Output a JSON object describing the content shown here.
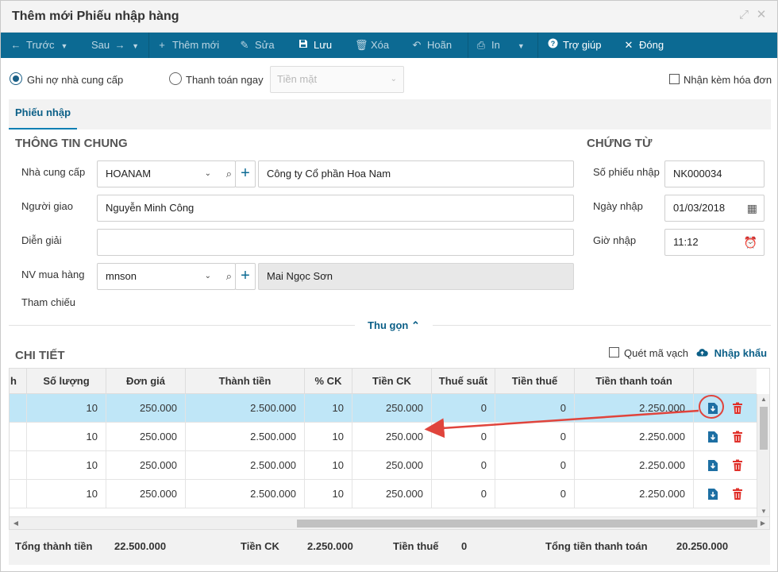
{
  "window": {
    "title": "Thêm mới Phiếu nhập hàng"
  },
  "toolbar": {
    "prev": "Trước",
    "next": "Sau",
    "add": "Thêm mới",
    "edit": "Sửa",
    "save": "Lưu",
    "delete": "Xóa",
    "undo": "Hoãn",
    "print": "In",
    "help": "Trợ giúp",
    "close": "Đóng"
  },
  "payment": {
    "debt_label": "Ghi nợ nhà cung cấp",
    "pay_now_label": "Thanh toán ngay",
    "method_placeholder": "Tiền mặt",
    "invoice_label": "Nhận kèm hóa đơn"
  },
  "tabs": {
    "main": "Phiếu nhập"
  },
  "general": {
    "heading": "THÔNG TIN CHUNG",
    "supplier_label": "Nhà cung cấp",
    "supplier_code": "HOANAM",
    "supplier_name": "Công ty Cổ phần Hoa Nam",
    "deliverer_label": "Người giao",
    "deliverer": "Nguyễn Minh Công",
    "note_label": "Diễn giải",
    "note": "",
    "buyer_label": "NV mua hàng",
    "buyer_code": "mnson",
    "buyer_name": "Mai Ngọc Sơn",
    "ref_label": "Tham chiếu"
  },
  "voucher": {
    "heading": "CHỨNG TỪ",
    "number_label": "Số phiếu nhập",
    "number": "NK000034",
    "date_label": "Ngày nhập",
    "date": "01/03/2018",
    "time_label": "Giờ nhập",
    "time": "11:12"
  },
  "collapse_label": "Thu gọn",
  "detail": {
    "heading": "CHI TIẾT",
    "scan_label": "Quét mã vạch",
    "import_label": "Nhập khẩu",
    "columns": [
      "h",
      "Số lượng",
      "Đơn giá",
      "Thành tiền",
      "% CK",
      "Tiền CK",
      "Thuế suất",
      "Tiền thuế",
      "Tiền thanh toán"
    ],
    "rows": [
      [
        "10",
        "250.000",
        "2.500.000",
        "10",
        "250.000",
        "0",
        "0",
        "2.250.000"
      ],
      [
        "10",
        "250.000",
        "2.500.000",
        "10",
        "250.000",
        "0",
        "0",
        "2.250.000"
      ],
      [
        "10",
        "250.000",
        "2.500.000",
        "10",
        "250.000",
        "0",
        "0",
        "2.250.000"
      ],
      [
        "10",
        "250.000",
        "2.500.000",
        "10",
        "250.000",
        "0",
        "0",
        "2.250.000"
      ]
    ]
  },
  "totals": {
    "subtotal_label": "Tổng thành tiền",
    "subtotal": "22.500.000",
    "discount_label": "Tiền CK",
    "discount": "2.250.000",
    "tax_label": "Tiền thuế",
    "tax": "0",
    "grand_label": "Tổng tiền thanh toán",
    "grand": "20.250.000"
  },
  "colors": {
    "toolbar": "#0c6a93",
    "accent": "#0b5f87",
    "selected_row": "#bfe6f7",
    "annotation": "#e0443c",
    "delete": "#e0302a"
  }
}
